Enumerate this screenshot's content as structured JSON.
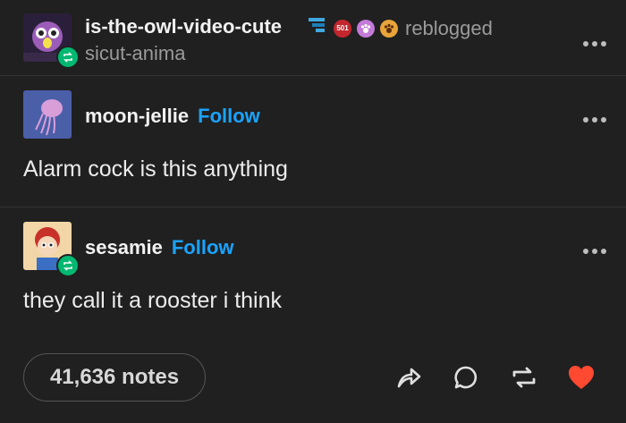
{
  "header": {
    "reblogger": "is-the-owl-video-cute",
    "reblogged_label": "reblogged",
    "source": "sicut-anima",
    "badge_icons": [
      "steps-badge-icon",
      "red-hexagon-badge-icon",
      "paw-pink-badge-icon",
      "paw-orange-badge-icon"
    ],
    "hex_badge_text": "501"
  },
  "posts": [
    {
      "author": "moon-jellie",
      "follow_label": "Follow",
      "text": "Alarm cock is this anything"
    },
    {
      "author": "sesamie",
      "follow_label": "Follow",
      "text": "they call it a rooster i think"
    }
  ],
  "footer": {
    "notes_label": "41,636 notes",
    "actions": [
      "share-icon",
      "reply-icon",
      "reblog-icon",
      "like-icon"
    ]
  },
  "colors": {
    "background": "#202020",
    "follow": "#1aa3ff",
    "reblog_badge": "#00b871",
    "like": "#ff4930"
  }
}
